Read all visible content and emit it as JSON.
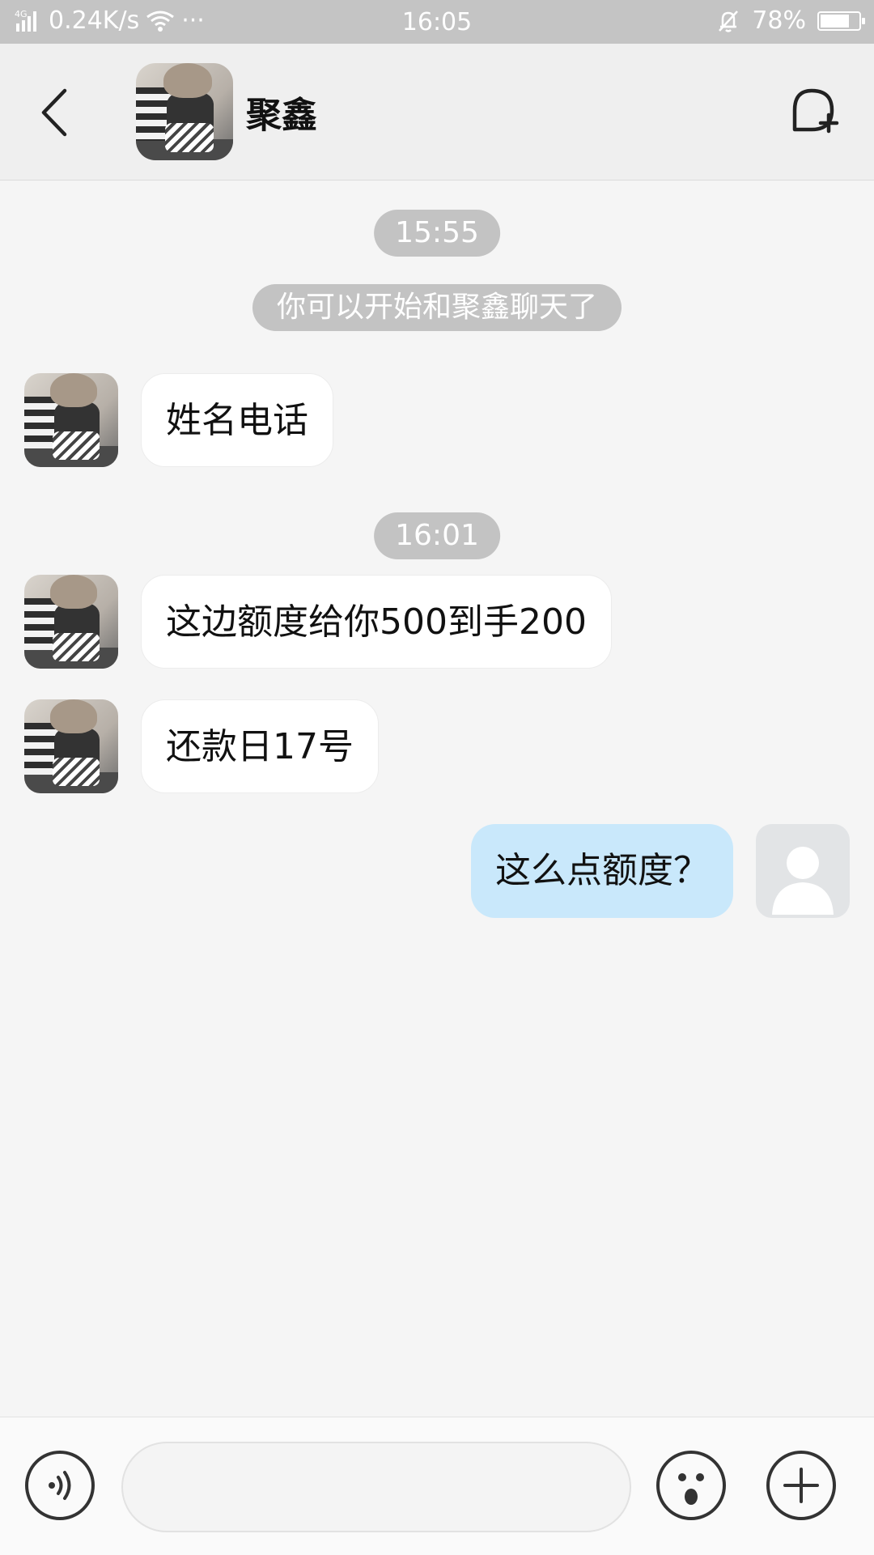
{
  "status_bar": {
    "network": "4G",
    "speed": "0.24K/s",
    "more": "···",
    "time": "16:05",
    "battery": "78%",
    "battery_level": 0.78
  },
  "header": {
    "title": "聚鑫",
    "back_icon": "chevron-left-icon",
    "add_chat_icon": "chat-add-icon"
  },
  "messages": [
    {
      "type": "time",
      "text": "15:55"
    },
    {
      "type": "system",
      "text": "你可以开始和聚鑫聊天了"
    },
    {
      "type": "incoming",
      "text": "姓名电话"
    },
    {
      "type": "time",
      "text": "16:01"
    },
    {
      "type": "incoming",
      "text": "这边额度给你500到手200"
    },
    {
      "type": "incoming",
      "text": "还款日17号"
    },
    {
      "type": "outgoing",
      "text": "这么点额度？"
    }
  ],
  "input_bar": {
    "voice_icon": "voice-icon",
    "emoji_icon": "emoji-icon",
    "plus_icon": "plus-icon",
    "input_value": "",
    "input_placeholder": ""
  },
  "colors": {
    "status_bar_bg": "#c4c4c4",
    "nav_bg": "#efefef",
    "chat_bg": "#f5f5f5",
    "incoming_bubble": "#ffffff",
    "outgoing_bubble": "#c9e8fb",
    "pill_bg": "#c3c3c3"
  }
}
